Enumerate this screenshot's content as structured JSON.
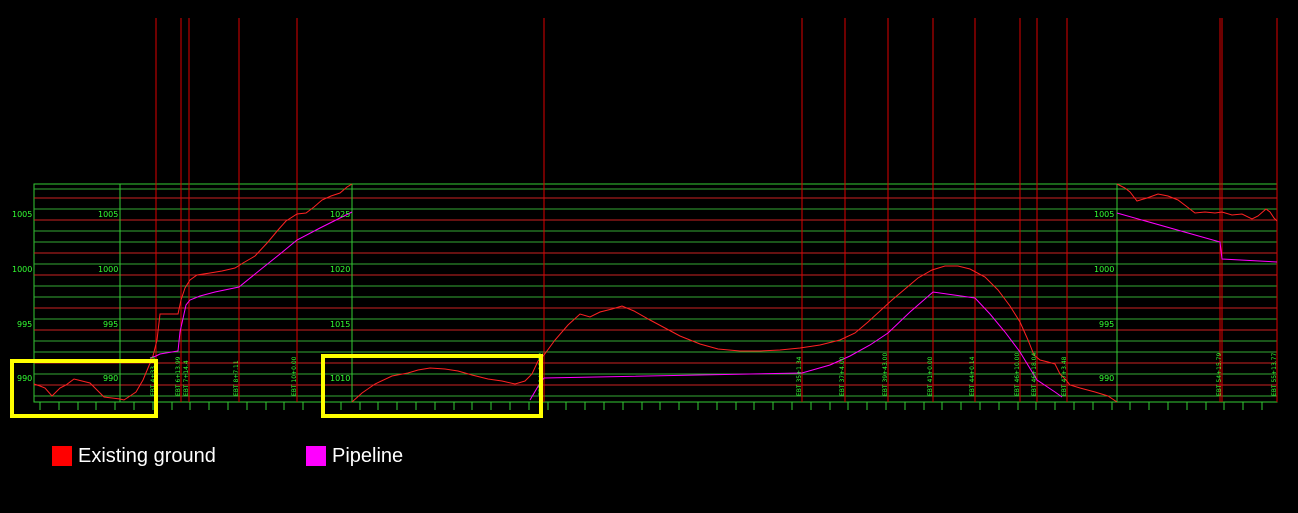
{
  "legend": [
    {
      "label": "Existing ground",
      "color": "#ff0000"
    },
    {
      "label": "Pipeline",
      "color": "#ff00ff"
    }
  ],
  "colors": {
    "background": "#000000",
    "existing_ground": "#ff0000",
    "pipeline": "#ff00ff",
    "frame_grid": "#33cc33",
    "labels": "#33ff33",
    "highlight": "#ffff00"
  },
  "elevation_labels": {
    "panel_1_outer": [
      "1005",
      "1000",
      "995",
      "990"
    ],
    "panel_1_inner": [
      "1005",
      "1000",
      "995",
      "990"
    ],
    "panel_2": [
      "1025",
      "1020",
      "1015",
      "1010"
    ],
    "panel_4": [
      "1005",
      "1000",
      "995",
      "990"
    ]
  },
  "station_labels": [
    "EBT 4+33.79",
    "EBT 6+13.99",
    "EBT 7+14.4",
    "EBT 8+7.11",
    "EBT 10+0.00",
    "EBT 14+13.72",
    "EBT 35+1.34",
    "EBT 37+4.00",
    "EBT 39+43.00",
    "EBT 41+0.00",
    "EBT 44+0.14",
    "EBT 46+10.00",
    "EBT 46+18.04",
    "EBT 47+3.48",
    "EBT 54+15.79",
    "EBT 55+13.77"
  ]
}
